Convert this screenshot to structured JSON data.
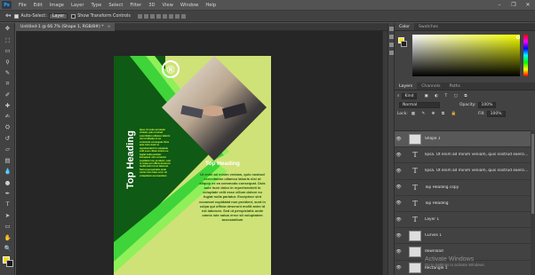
{
  "menubar": {
    "logo": "Ps",
    "items": [
      "File",
      "Edit",
      "Image",
      "Layer",
      "Type",
      "Select",
      "Filter",
      "3D",
      "View",
      "Window",
      "Help"
    ],
    "window_controls": [
      "minimize-icon",
      "maximize-icon",
      "close-icon"
    ]
  },
  "options": {
    "auto_select_label": "Auto-Select:",
    "auto_select_value": "Layer",
    "transform_label": "Show Transform Controls"
  },
  "tools": [
    "move-icon",
    "artboard-icon",
    "marquee-icon",
    "lasso-icon",
    "quick-select-icon",
    "crop-icon",
    "eyedropper-icon",
    "healing-icon",
    "brush-icon",
    "stamp-icon",
    "history-brush-icon",
    "eraser-icon",
    "gradient-icon",
    "blur-icon",
    "dodge-icon",
    "pen-icon",
    "type-icon",
    "path-select-icon",
    "rectangle-icon",
    "hand-icon",
    "zoom-icon",
    "more-icon"
  ],
  "tool_glyphs": [
    "✥",
    "⬚",
    "▭",
    "ϙ",
    "✎",
    "⌗",
    "✐",
    "✚",
    "✍",
    "⛭",
    "↺",
    "▱",
    "▤",
    "💧",
    "●",
    "✒",
    "T",
    "➤",
    "▭",
    "✋",
    "🔍",
    "…"
  ],
  "document": {
    "tab_title": "Untitled-1 @ 66.7% (Shape 1, RGB/8#) *",
    "tab_close": "×"
  },
  "poster": {
    "vertical_heading": "Top Heading",
    "logo_mark": "®",
    "left_text": "lipsa. Ut enim ad minim veniam, quis nostrud exercitation ullamco laboris nisi ut aliquip ex ea commodo consequat. Duis aute irure dolor in reprehenderit in voluptate velit esse cillum dolore eu fugiat nulla pariatur. Excepteur sint occaecat cupidatat non proident, sunt in culpa qui officia deserunt mollit anim id est laborum. Sed ut perspiciatis unde omnis iste natus error sit voluptatem accusantium",
    "right_heading": "Top Heading",
    "right_text": "Ut enim ad minim veniam, quis nostrud exercitation ullamco laboris nisi ut aliquip ex ea commodo consequat. Duis aute irure dolor in reprehenderit in voluptate velit esse cillum dolore eu fugiat nulla pariatur. Excepteur sint occaecat cupidatat non proident, sunt in culpa qui officia deserunt mollit anim id est laborum. Sed ut perspiciatis unde omnis iste natus error sit voluptatem accusantium",
    "colors": {
      "background": "#cfe277",
      "dark_green": "#0f5a14",
      "stripe": "#3fd43a",
      "stripe_light": "#8ff05a"
    }
  },
  "color_panel": {
    "tabs": [
      "Color",
      "Swatches"
    ],
    "foreground": "#ffe900",
    "background": "#202020"
  },
  "layers_panel": {
    "tabs": [
      "Layers",
      "Channels",
      "Paths"
    ],
    "kind_label": "Kind",
    "blend_mode": "Normal",
    "opacity_label": "Opacity:",
    "opacity_value": "100%",
    "lock_label": "Lock:",
    "fill_label": "Fill:",
    "fill_value": "100%",
    "layers": [
      {
        "name": "Shape 1",
        "thumb": "image",
        "selected": true
      },
      {
        "name": "lipsa. Ut enim ad minim veniam, quis nostrud exercitati...",
        "thumb": "text",
        "selected": false
      },
      {
        "name": "lipsa. Ut enim ad minim veniam, quis nostrud exercitati...",
        "thumb": "text",
        "selected": false
      },
      {
        "name": "Top Heading copy",
        "thumb": "text",
        "selected": false
      },
      {
        "name": "Top Heading",
        "thumb": "text",
        "selected": false
      },
      {
        "name": "Layer 1",
        "thumb": "text",
        "selected": false
      },
      {
        "name": "Curves 1",
        "thumb": "image",
        "selected": false
      },
      {
        "name": "download",
        "thumb": "image",
        "selected": false
      },
      {
        "name": "Rectangle 1",
        "thumb": "image",
        "selected": false
      }
    ]
  },
  "watermark": {
    "line1": "Activate Windows",
    "line2": "Go to Settings to activate Windows."
  }
}
